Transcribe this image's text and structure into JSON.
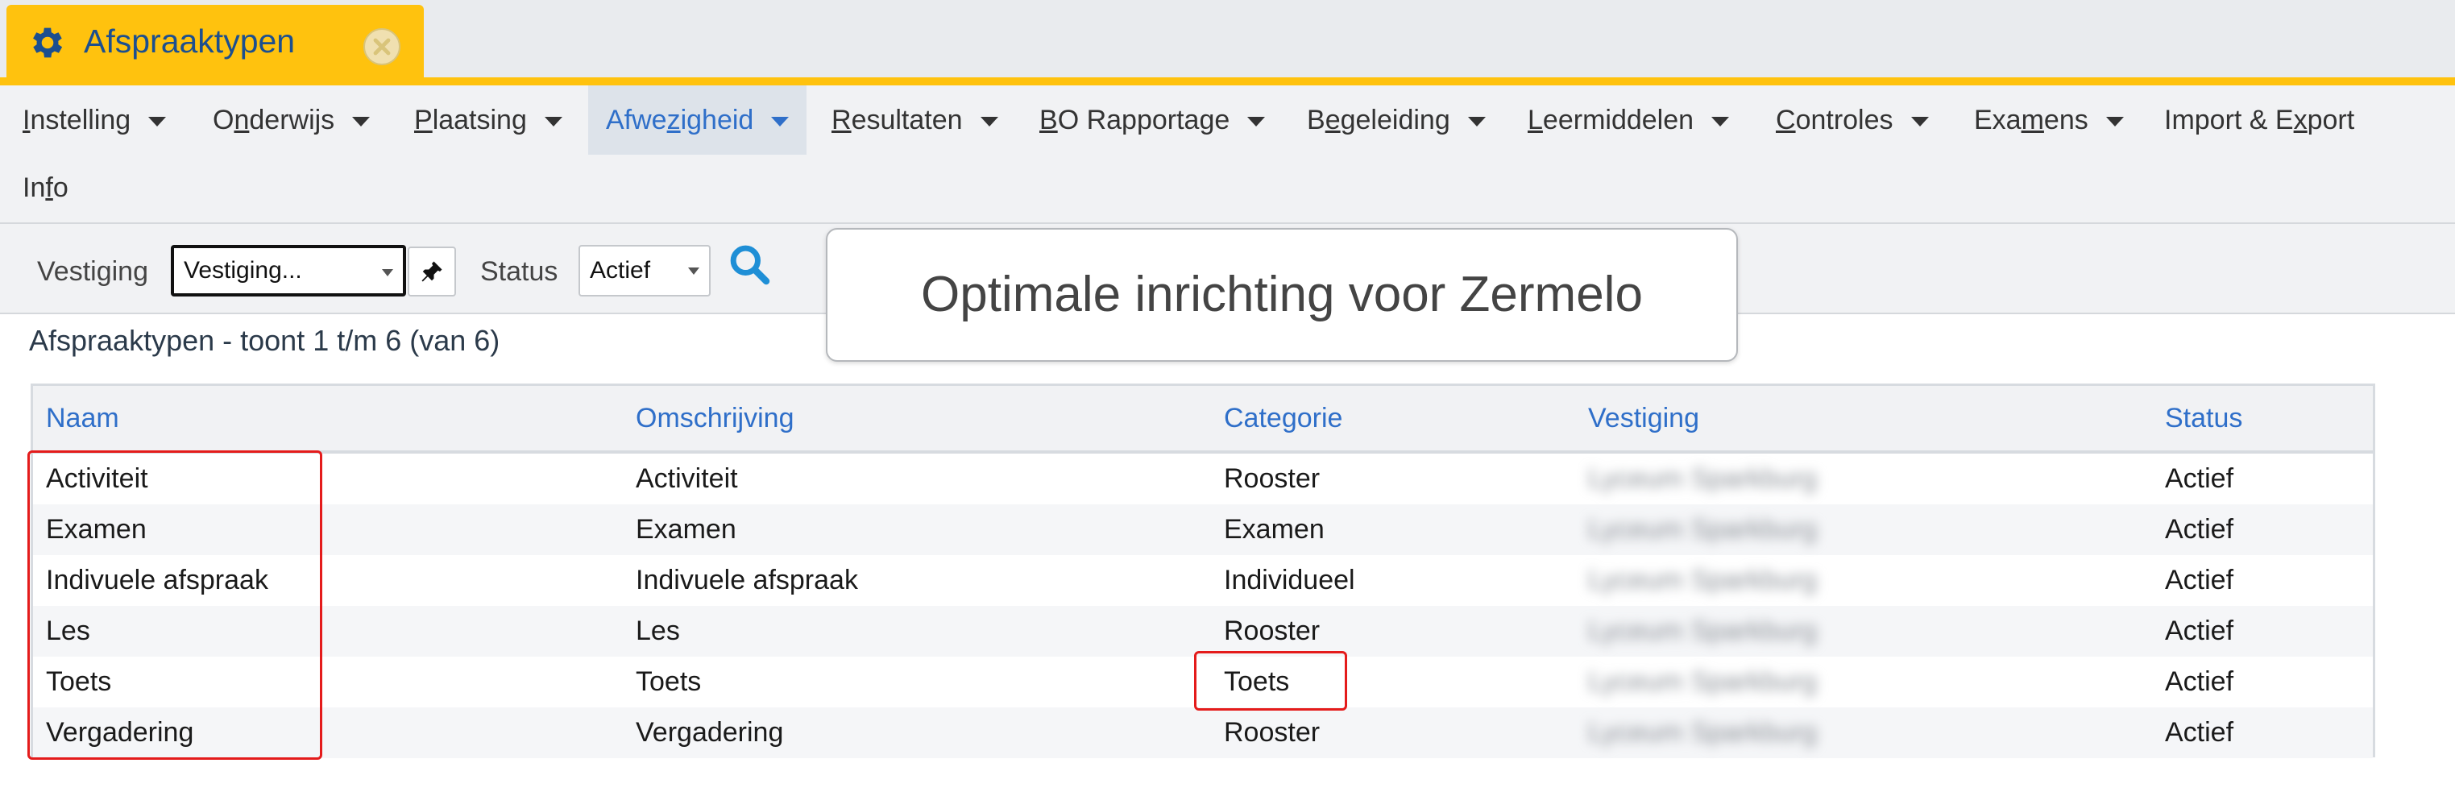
{
  "tab": {
    "title": "Afspraaktypen",
    "icon": "gear-icon",
    "close_icon": "close-circle-icon"
  },
  "menu": [
    {
      "pre": "",
      "ul": "I",
      "post": "nstelling"
    },
    {
      "pre": "O",
      "ul": "n",
      "post": "derwijs"
    },
    {
      "pre": "",
      "ul": "P",
      "post": "laatsing"
    },
    {
      "pre": "Afwe",
      "ul": "z",
      "post": "igheid"
    },
    {
      "pre": "",
      "ul": "R",
      "post": "esultaten"
    },
    {
      "pre": "",
      "ul": "B",
      "post": "O Rapportage"
    },
    {
      "pre": "B",
      "ul": "e",
      "post": "geleiding"
    },
    {
      "pre": "",
      "ul": "L",
      "post": "eermiddelen"
    },
    {
      "pre": "",
      "ul": "C",
      "post": "ontroles"
    },
    {
      "pre": "Exa",
      "ul": "m",
      "post": "ens"
    },
    {
      "pre": "Import & E",
      "ul": "x",
      "post": "port"
    },
    {
      "pre": "In",
      "ul": "f",
      "post": "o"
    }
  ],
  "filters": {
    "vestiging_label": "Vestiging",
    "vestiging_value": "Vestiging...",
    "status_label": "Status",
    "status_value": "Actief"
  },
  "callout": "Optimale inrichting voor Zermelo",
  "listing": {
    "title": "Afspraaktypen - toont 1 t/m 6 (van 6)",
    "columns": [
      "Naam",
      "Omschrijving",
      "Categorie",
      "Vestiging",
      "Status"
    ],
    "rows": [
      [
        "Activiteit",
        "Activiteit",
        "Rooster",
        "Lyceum Sparkburg",
        "Actief"
      ],
      [
        "Examen",
        "Examen",
        "Examen",
        "Lyceum Sparkburg",
        "Actief"
      ],
      [
        "Indivuele afspraak",
        "Indivuele afspraak",
        "Individueel",
        "Lyceum Sparkburg",
        "Actief"
      ],
      [
        "Les",
        "Les",
        "Rooster",
        "Lyceum Sparkburg",
        "Actief"
      ],
      [
        "Toets",
        "Toets",
        "Toets",
        "Lyceum Sparkburg",
        "Actief"
      ],
      [
        "Vergadering",
        "Vergadering",
        "Rooster",
        "Lyceum Sparkburg",
        "Actief"
      ]
    ]
  },
  "colors": {
    "accent": "#ffc20e",
    "link": "#2f6fc9",
    "highlight": "#e41b1b"
  }
}
